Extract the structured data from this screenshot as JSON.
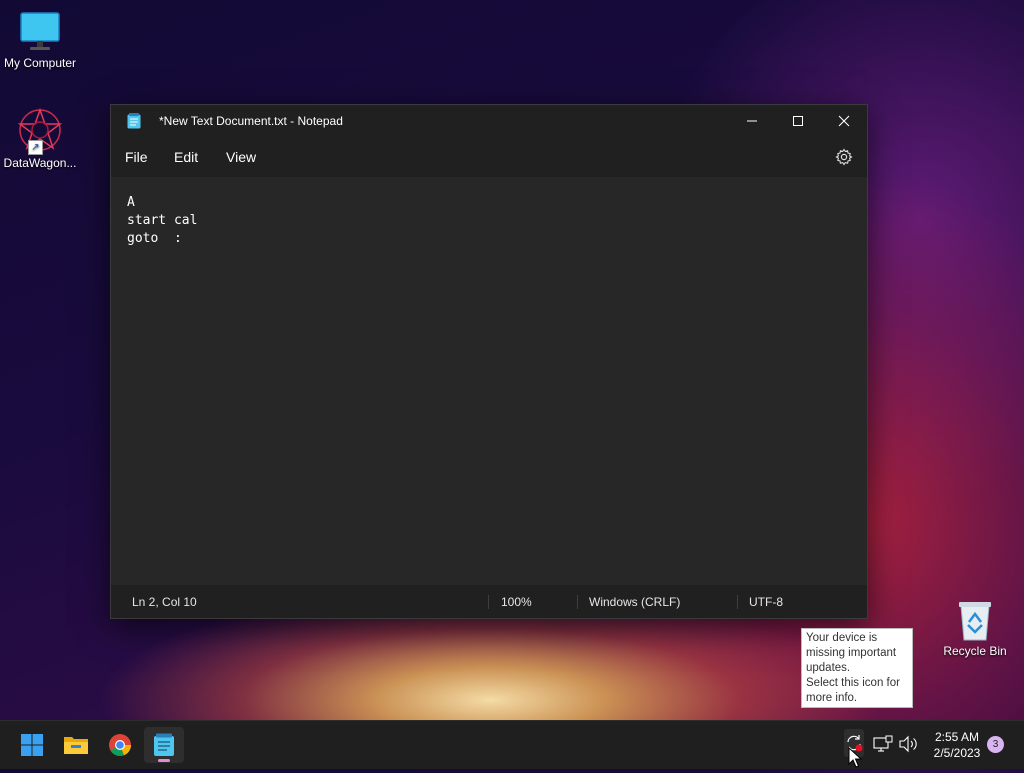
{
  "desktop": {
    "icons": [
      {
        "label": "My Computer"
      },
      {
        "label": "DataWagon..."
      },
      {
        "label": "Recycle Bin"
      }
    ]
  },
  "notepad": {
    "title": "*New Text Document.txt - Notepad",
    "menu": [
      "File",
      "Edit",
      "View"
    ],
    "content": "A\nstart cal\ngoto  :",
    "status": {
      "position": "Ln 2, Col 10",
      "zoom": "100%",
      "line_ending": "Windows (CRLF)",
      "encoding": "UTF-8"
    }
  },
  "tooltip": {
    "line1": "Your device is missing important updates.",
    "line2": "Select this icon for more info."
  },
  "taskbar": {
    "apps": [
      "start-icon",
      "file-explorer-icon",
      "chrome-icon",
      "notepad-icon"
    ],
    "clock": {
      "time": "2:55 AM",
      "date": "2/5/2023"
    },
    "notification_count": "3"
  },
  "colors": {
    "accent_indicator": "#e58ad6",
    "update_dot": "#e81123"
  }
}
